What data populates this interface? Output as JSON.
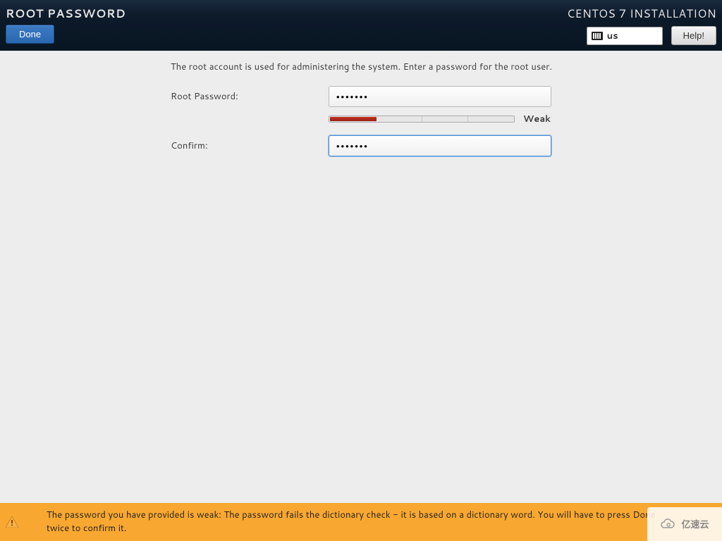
{
  "header": {
    "title": "ROOT PASSWORD",
    "done_label": "Done",
    "install_title": "CENTOS 7 INSTALLATION",
    "keyboard_layout": "us",
    "help_label": "Help!"
  },
  "form": {
    "instruction": "The root account is used for administering the system.  Enter a password for the root user.",
    "root_password_label": "Root Password:",
    "root_password_value": "•••••••",
    "confirm_label": "Confirm:",
    "confirm_value": "•••••••",
    "strength_text": "Weak",
    "strength_fill_percent": 25
  },
  "warning": {
    "message": "The password you have provided is weak: The password fails the dictionary check - it is based on a dictionary word. You will have to press Done twice to confirm it."
  },
  "watermark": {
    "text": "亿速云"
  }
}
